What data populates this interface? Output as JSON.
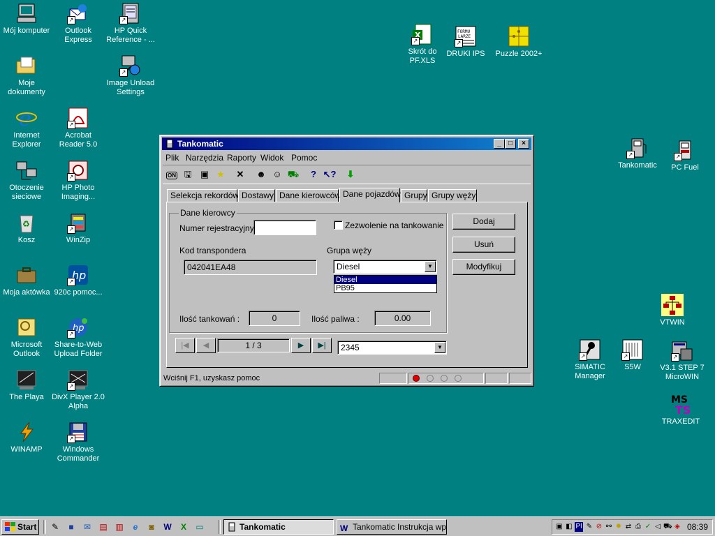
{
  "desktop": {
    "icons": [
      {
        "label": "Mój komputer"
      },
      {
        "label": "Outlook Express"
      },
      {
        "label": "HP Quick Reference - ..."
      },
      {
        "label": "Moje dokumenty"
      },
      {
        "label": "Image Unload Settings"
      },
      {
        "label": "Internet Explorer"
      },
      {
        "label": "Acrobat Reader 5.0"
      },
      {
        "label": "Otoczenie sieciowe"
      },
      {
        "label": "HP Photo Imaging..."
      },
      {
        "label": "Kosz"
      },
      {
        "label": "WinZip"
      },
      {
        "label": "Moja aktówka"
      },
      {
        "label": "920c pomoc..."
      },
      {
        "label": "Microsoft Outlook"
      },
      {
        "label": "Share-to-Web Upload Folder"
      },
      {
        "label": "The Playa"
      },
      {
        "label": "DivX Player 2.0 Alpha"
      },
      {
        "label": "WINAMP"
      },
      {
        "label": "Windows Commander"
      },
      {
        "label": "Skrót do PF.XLS"
      },
      {
        "label": "DRUKI IPS"
      },
      {
        "label": "Puzzle 2002+"
      },
      {
        "label": "Tankomatic"
      },
      {
        "label": "PC Fuel"
      },
      {
        "label": "VTWIN"
      },
      {
        "label": "SIMATIC Manager"
      },
      {
        "label": "S5W"
      },
      {
        "label": "V3.1 STEP 7 MicroWIN"
      },
      {
        "label": "TRAXEDIT"
      }
    ]
  },
  "window": {
    "title": "Tankomatic",
    "menu": [
      "Plik",
      "Narzędzia",
      "Raporty",
      "Widok",
      "Pomoc"
    ],
    "tabs": [
      "Selekcja rekordów",
      "Dostawy",
      "Dane kierowców",
      "Dane pojazdów",
      "Grupy",
      "Grupy węży"
    ],
    "group_title": "Dane kierowcy",
    "numer_label": "Numer rejestracyjny",
    "numer_value": "",
    "checkbox_label": "Zezwolenie na tankowanie",
    "kod_label": "Kod transpondera",
    "kod_value": "042041EA48",
    "grupa_label": "Grupa węży",
    "grupa_value": "Diesel",
    "grupa_options": [
      "Diesel",
      "PB95"
    ],
    "ilosc_tank_label": "Ilość tankowań :",
    "ilosc_tank_value": "0",
    "ilosc_paliwa_label": "Ilość paliwa :",
    "ilosc_paliwa_value": "0.00",
    "btn_dodaj": "Dodaj",
    "btn_usun": "Usuń",
    "btn_modyfikuj": "Modyfikuj",
    "record_pos": "1 / 3",
    "record_combo": "2345",
    "status_text": "Wciśnij F1, uzyskasz pomoc"
  },
  "taskbar": {
    "start": "Start",
    "tasks": [
      "Tankomatic",
      "Tankomatic Instrukcja wpr..."
    ],
    "clock": "08:39"
  }
}
